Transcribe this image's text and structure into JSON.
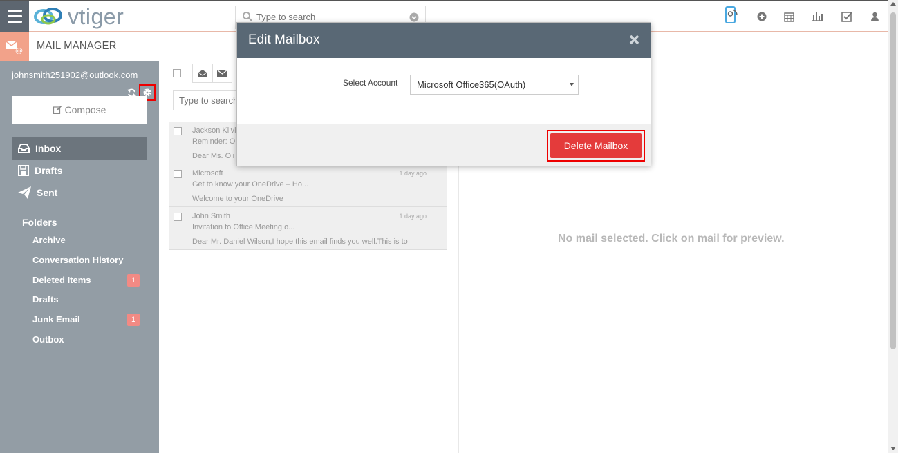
{
  "brand": {
    "logo_text": "vtiger",
    "accent": "#f2a28a"
  },
  "header": {
    "search_placeholder": "Type to search",
    "icons": [
      "mobile-icon",
      "add-icon",
      "calendar-icon",
      "reports-icon",
      "tasks-icon",
      "user-icon"
    ]
  },
  "module": {
    "title": "MAIL MANAGER"
  },
  "sidebar": {
    "account": "johnsmith251902@outlook.com",
    "compose_label": "Compose",
    "nav": [
      {
        "label": "Inbox",
        "active": true
      },
      {
        "label": "Drafts",
        "active": false
      },
      {
        "label": "Sent",
        "active": false
      }
    ],
    "folders_title": "Folders",
    "folders": [
      {
        "label": "Archive",
        "badge": ""
      },
      {
        "label": "Conversation History",
        "badge": ""
      },
      {
        "label": "Deleted Items",
        "badge": "1"
      },
      {
        "label": "Drafts",
        "badge": ""
      },
      {
        "label": "Junk Email",
        "badge": "1"
      },
      {
        "label": "Outbox",
        "badge": ""
      }
    ]
  },
  "list": {
    "search_placeholder": "Type to search",
    "mails": [
      {
        "from": "Jackson Kilvin",
        "subject": "Reminder: O",
        "preview": "Dear Ms. Oli",
        "date": ""
      },
      {
        "from": "Microsoft",
        "subject": "Get to know your OneDrive – Ho...",
        "preview": "Welcome to your OneDrive",
        "date": "1 day ago"
      },
      {
        "from": "John Smith",
        "subject": "Invitation to Office Meeting o...",
        "preview": "Dear Mr. Daniel Wilson,I hope this email finds you well.This is to",
        "date": "1 day ago"
      }
    ]
  },
  "preview": {
    "empty_text": "No mail selected. Click on mail for preview."
  },
  "modal": {
    "title": "Edit Mailbox",
    "select_label": "Select Account",
    "selected_account": "Microsoft Office365(OAuth)",
    "delete_label": "Delete Mailbox"
  }
}
